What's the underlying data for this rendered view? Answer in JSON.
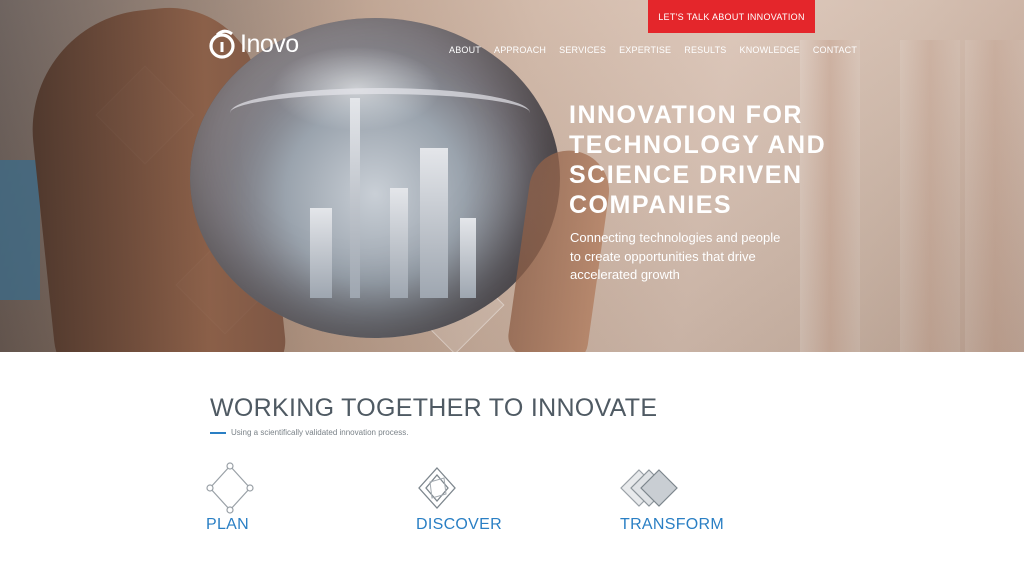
{
  "header": {
    "cta_label": "LET'S TALK ABOUT INNOVATION",
    "logo_text": "Inovo",
    "nav": [
      "ABOUT",
      "APPROACH",
      "SERVICES",
      "EXPERTISE",
      "RESULTS",
      "KNOWLEDGE",
      "CONTACT"
    ]
  },
  "hero": {
    "title_lines": [
      "INNOVATION FOR",
      "TECHNOLOGY AND",
      "SCIENCE DRIVEN",
      "COMPANIES"
    ],
    "subtitle_lines": [
      "Connecting technologies and people",
      "to create opportunities that drive",
      "accelerated growth"
    ]
  },
  "main": {
    "title": "WORKING TOGETHER TO INNOVATE",
    "subtitle": "Using a scientifically validated innovation process.",
    "steps": [
      {
        "label": "PLAN",
        "icon": "diamond-nodes-icon"
      },
      {
        "label": "DISCOVER",
        "icon": "nested-diamond-icon"
      },
      {
        "label": "TRANSFORM",
        "icon": "stacked-diamonds-icon"
      }
    ]
  },
  "colors": {
    "accent_red": "#e4262b",
    "accent_blue": "#2a7fc4",
    "heading_gray": "#4f5a63"
  }
}
